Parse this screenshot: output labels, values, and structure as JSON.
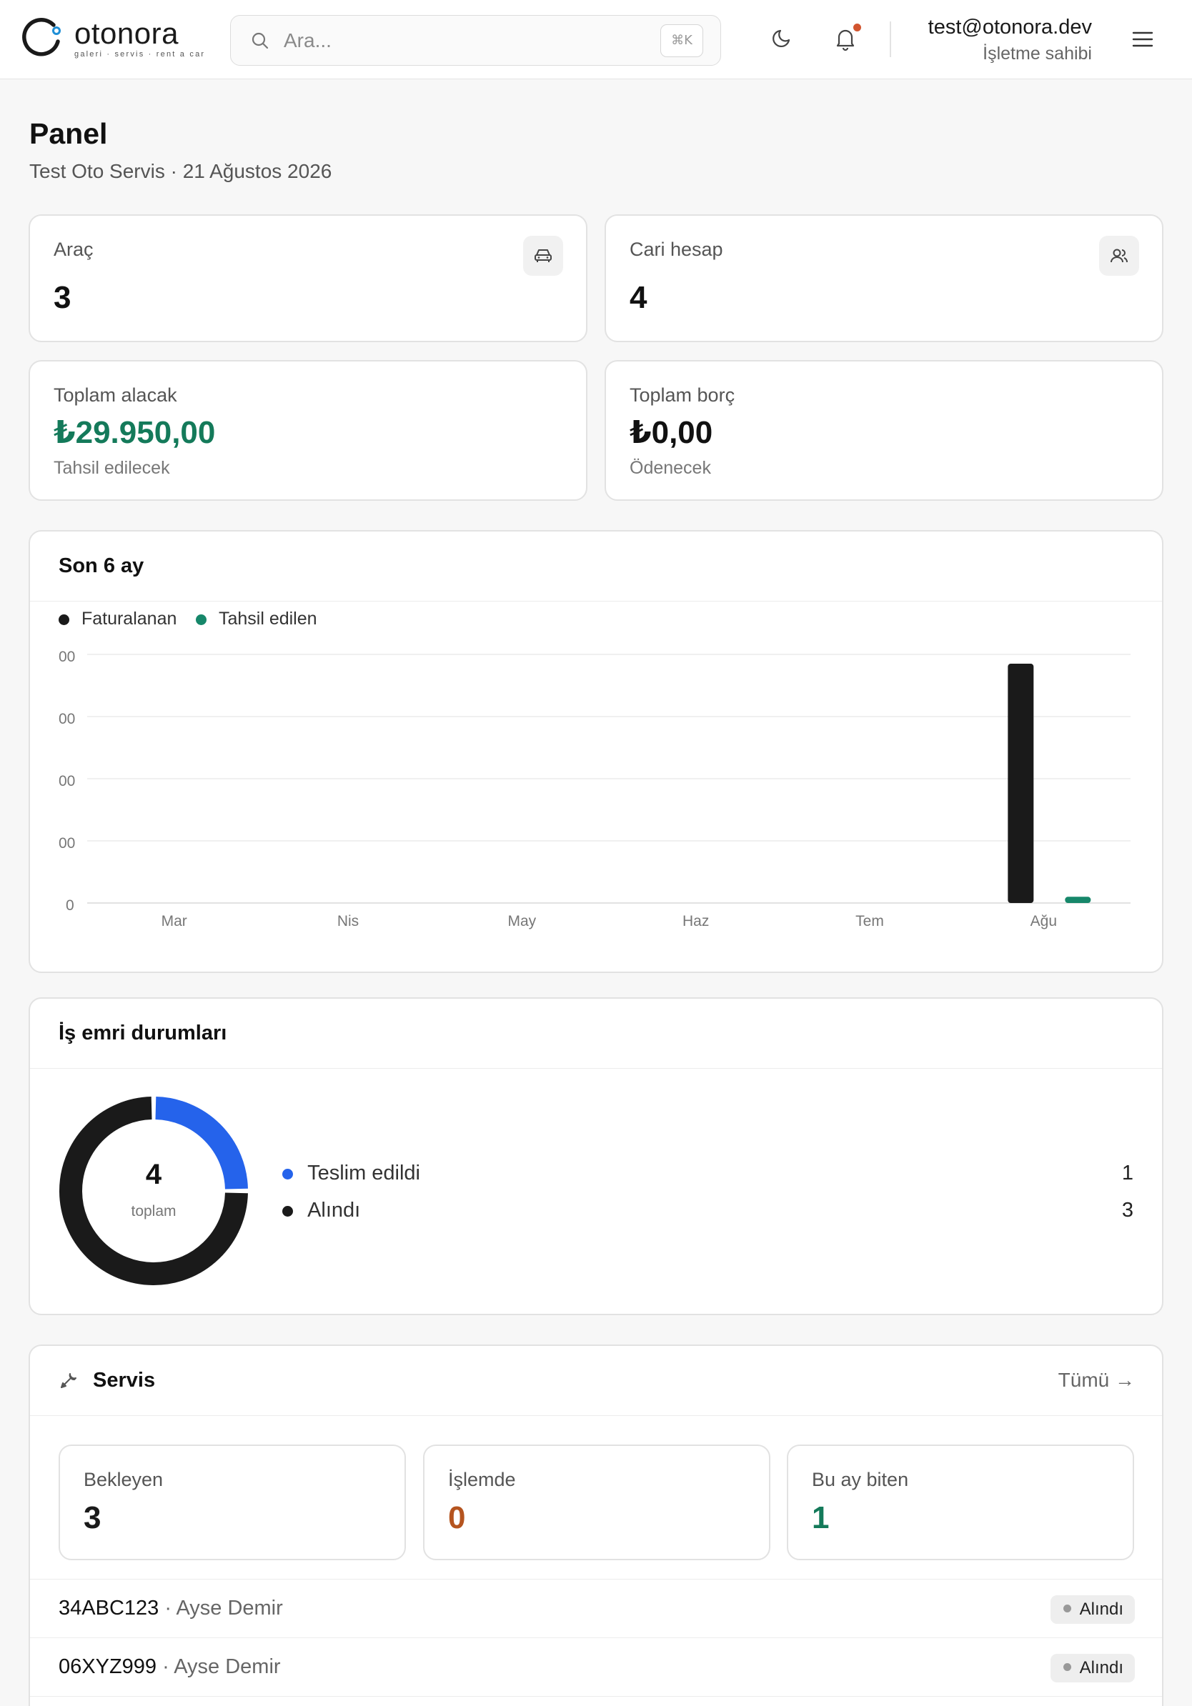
{
  "app": {
    "logo_text": "otonora",
    "logo_tagline": "galeri · servis · rent a car",
    "accent_color": "#1f8fd6"
  },
  "header": {
    "search_placeholder": "Ara...",
    "search_shortcut": "⌘K",
    "icons": [
      "moon-icon",
      "bell-icon",
      "menu-icon"
    ],
    "has_notification": true,
    "user_email": "test@otonora.dev",
    "user_role": "İşletme sahibi"
  },
  "page": {
    "title": "Panel",
    "subtitle": "Test Oto Servis · 21 Ağustos 2026"
  },
  "stats": {
    "vehicles": {
      "label": "Araç",
      "value": "3",
      "icon": "car-icon"
    },
    "accounts": {
      "label": "Cari hesap",
      "value": "4",
      "icon": "users-icon"
    },
    "receivable": {
      "label": "Toplam alacak",
      "value": "₺29.950,00",
      "note": "Tahsil edilecek",
      "color": "#147a5a"
    },
    "payable": {
      "label": "Toplam borç",
      "value": "₺0,00",
      "note": "Ödenecek"
    }
  },
  "revenue_chart": {
    "title": "Son 6 ay",
    "legend": [
      {
        "label": "Faturalanan",
        "color": "#1a1a1a"
      },
      {
        "label": "Tahsil edilen",
        "color": "#16876a"
      }
    ],
    "y_ticks": [
      "00",
      "00",
      "00",
      "00",
      "0"
    ]
  },
  "chart_data": {
    "type": "bar",
    "title": "Son 6 ay",
    "categories": [
      "Mar",
      "Nis",
      "May",
      "Haz",
      "Tem",
      "Ağu"
    ],
    "series": [
      {
        "name": "Faturalanan",
        "values": [
          0,
          0,
          0,
          0,
          0,
          3.85
        ]
      },
      {
        "name": "Tahsil edilen",
        "values": [
          0,
          0,
          0,
          0,
          0,
          0.1
        ]
      }
    ],
    "ylim": [
      0,
      4
    ],
    "grid": true,
    "legend_position": "top-left"
  },
  "work_orders": {
    "title": "İş emri durumları",
    "total": "4",
    "total_label": "toplam",
    "items": [
      {
        "label": "Teslim edildi",
        "count": "1",
        "value": 1,
        "color": "#2563eb"
      },
      {
        "label": "Alındı",
        "count": "3",
        "value": 3,
        "color": "#1a1a1a"
      }
    ]
  },
  "service": {
    "title": "Servis",
    "icon": "wrench-icon",
    "all_link": "Tümü →",
    "cards": [
      {
        "label": "Bekleyen",
        "value": "3",
        "color": "#1a1a1a"
      },
      {
        "label": "İşlemde",
        "value": "0",
        "color": "#b5541f"
      },
      {
        "label": "Bu ay biten",
        "value": "1",
        "color": "#147a5a"
      }
    ],
    "rows": [
      {
        "plate": "34ABC123",
        "customer": " · Ayse Demir",
        "status": "Alındı"
      },
      {
        "plate": "06XYZ999",
        "customer": " · Ayse Demir",
        "status": "Alındı"
      }
    ]
  }
}
